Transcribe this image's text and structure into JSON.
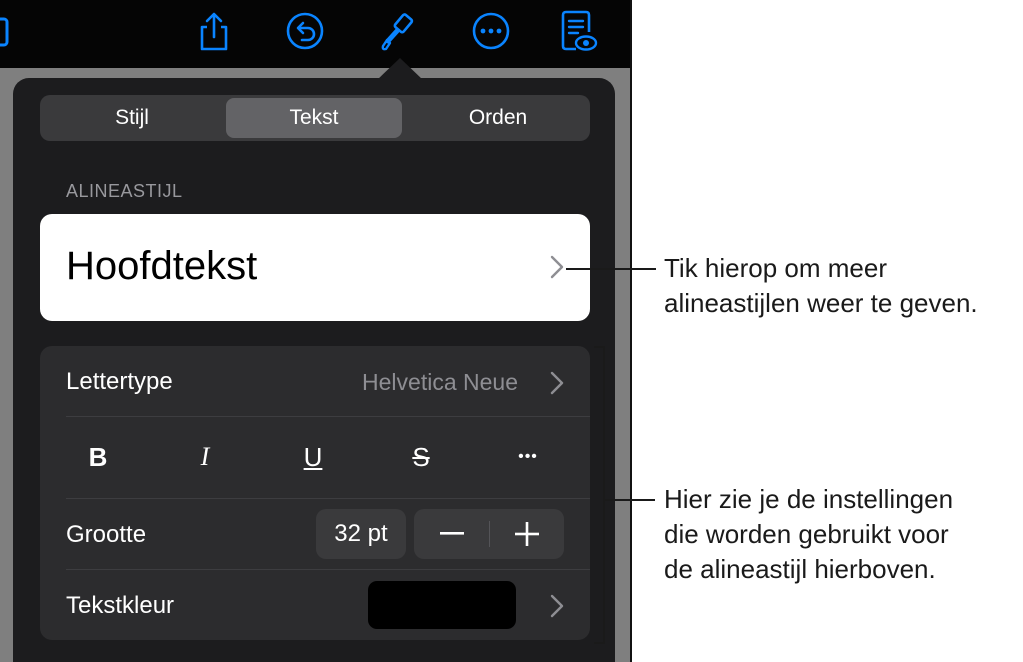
{
  "toolbar": {
    "icons": [
      "book-icon",
      "share-icon",
      "undo-icon",
      "format-brush-icon",
      "more-icon",
      "reader-view-icon"
    ],
    "accent_color": "#0a84ff"
  },
  "tabs": [
    {
      "label": "Stijl",
      "active": false
    },
    {
      "label": "Tekst",
      "active": true
    },
    {
      "label": "Orden",
      "active": false
    }
  ],
  "paragraph_style": {
    "section_header": "ALINEASTIJL",
    "value": "Hoofdtekst"
  },
  "settings": {
    "font_label": "Lettertype",
    "font_value": "Helvetica Neue",
    "format_buttons": {
      "bold": "B",
      "italic": "I",
      "underline": "U",
      "strikethrough": "S",
      "more": "•••"
    },
    "size_label": "Grootte",
    "size_value": "32 pt",
    "color_label": "Tekstkleur",
    "color_value": "#000000"
  },
  "callouts": {
    "first_line1": "Tik hierop om meer",
    "first_line2": "alineastijlen weer te geven.",
    "second_line1": "Hier zie je de instellingen",
    "second_line2": "die worden gebruikt voor",
    "second_line3": "de alineastijl hierboven."
  }
}
